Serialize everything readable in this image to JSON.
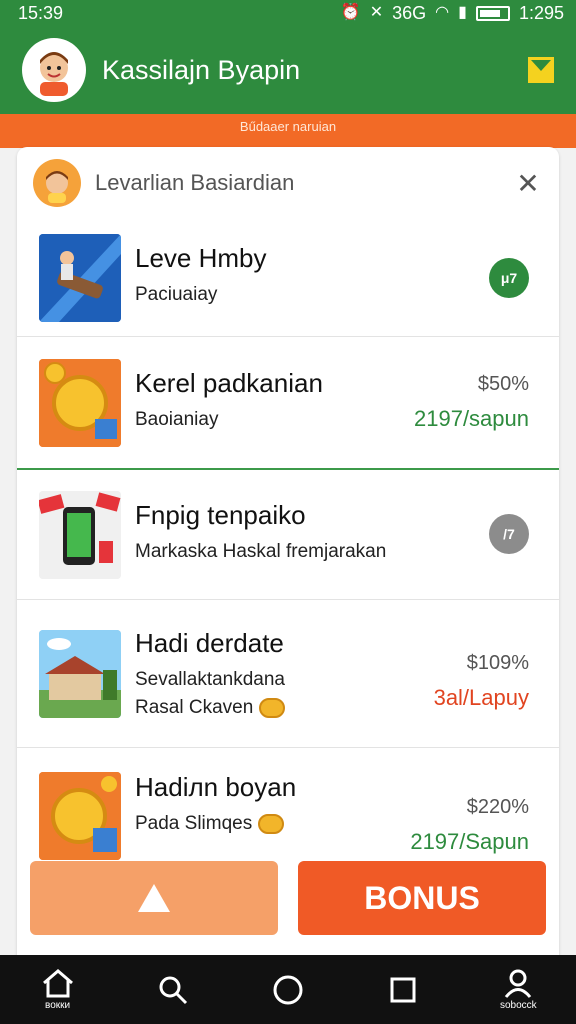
{
  "status": {
    "time": "15:39",
    "network": "36G",
    "clock_right": "1:295"
  },
  "appbar": {
    "title": "Kassilajn Byapin"
  },
  "strip": {
    "text": "Bűdaaer naruian"
  },
  "card": {
    "title": "Levarlian Basiardian",
    "items": [
      {
        "title": "Leve Hmby",
        "sub": "Paciuaiay",
        "badge": "μ7"
      },
      {
        "title": "Kerel padkanian",
        "sub": "Baoianiay",
        "price": "$50%",
        "price_sub": "2197/sapun",
        "price_sub_color": "#2e8b3e"
      },
      {
        "title": "Fnpig tenpaiko",
        "sub": "Markaska Haskal fremjarakan",
        "badge": "/7"
      },
      {
        "title": "Hadi derdate",
        "sub": "Sevallaktankdana",
        "sub2": "Rasal Ckaven",
        "price": "$109%",
        "price_sub": "3al/Lapuy",
        "price_sub_color": "#e14420"
      },
      {
        "title": "Hadiлn boyan",
        "sub": "Pada Slimqes",
        "price": "$220%",
        "price_sub": "2197/Sapun",
        "price_sub_color": "#2e8b3e"
      }
    ]
  },
  "buttons": {
    "bonus": "BONUS"
  },
  "navbar": {
    "home_label": "вокки",
    "profile_label": "sobocck"
  },
  "colors": {
    "primary_green": "#2e8b3e",
    "accent_orange": "#f05a26",
    "warn_button": "#f5a068"
  }
}
